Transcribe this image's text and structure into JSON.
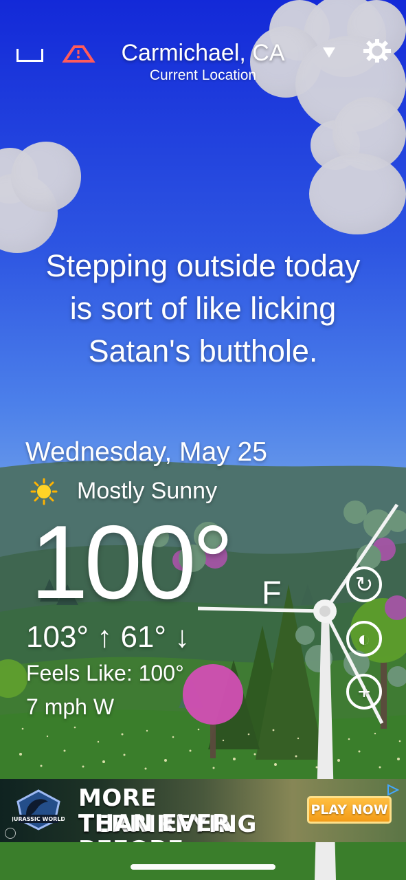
{
  "header": {
    "location_title": "Carmichael, CA",
    "location_subtitle": "Current Location"
  },
  "icons": {
    "left_icon_1": "square-icon",
    "left_icon_2": "alert-icon",
    "dropdown_icon": "chevron-down-icon",
    "settings_icon": "gear-icon",
    "weather_icon": "sun-icon",
    "refresh_icon": "refresh-icon",
    "moon_icon": "moon-icon",
    "add_icon": "plus-icon"
  },
  "forecast": {
    "quote_lines": [
      "Stepping outside today",
      "is sort of like licking",
      "Satan's butthole."
    ],
    "date": "Wednesday, May 25",
    "condition": "Mostly Sunny",
    "temperature": "100°",
    "unit": "F",
    "high_low": "103° ↑ 61° ↓",
    "feels_like": "Feels Like: 100°",
    "wind": "7 mph W"
  },
  "ad": {
    "brand": "JURASSIC WORLD",
    "line_1": "MORE TERRIRFYING",
    "line_2": "THAN EVER BEFORE",
    "cta": "PLAY NOW"
  },
  "colors": {
    "sky_top": "#1329d8",
    "sky_mid": "#4c80ea",
    "hill_green": "#356a2c",
    "accent_pink": "#d24fb4",
    "accent_orange": "#f39b17"
  }
}
